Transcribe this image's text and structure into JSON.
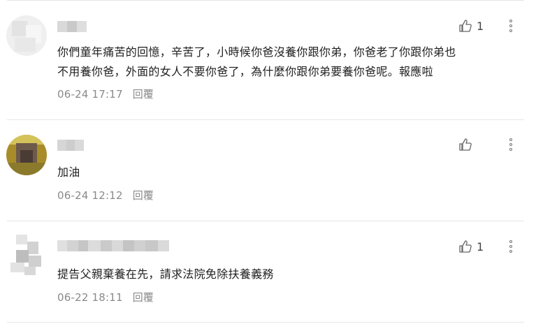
{
  "comments": [
    {
      "text_line1": "你們童年痛苦的回憶，辛苦了，小時候你爸沒養你跟你弟，你爸老了你跟你弟也",
      "text_line2": "不用養你爸，外面的女人不要你爸了，為什麼你跟你弟要養你爸呢。報應啦",
      "time": "06-24 17:17",
      "reply_label": "回覆",
      "likes": "1"
    },
    {
      "text_line1": "加油",
      "time": "06-24 12:12",
      "reply_label": "回覆",
      "likes": ""
    },
    {
      "text_line1": "提告父親棄養在先，請求法院免除扶養義務",
      "time": "06-22 18:11",
      "reply_label": "回覆",
      "likes": "1"
    }
  ],
  "icons": {
    "like": "thumbs-up-icon",
    "more": "vertical-dots-icon"
  },
  "colors": {
    "text": "#1f1f1f",
    "meta": "#8a8a8a",
    "divider": "#e6e6e6"
  }
}
